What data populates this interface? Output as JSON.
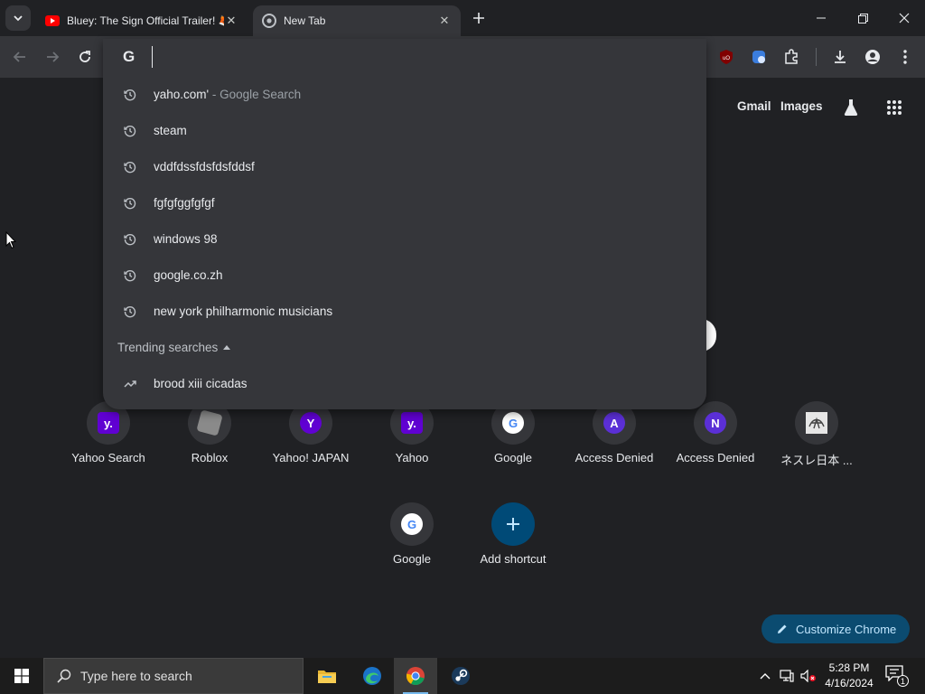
{
  "tabs": [
    {
      "title": "Bluey: The Sign Official Trailer! 🦊",
      "favicon": "youtube-icon",
      "active": false
    },
    {
      "title": "New Tab",
      "favicon": "chrome-icon",
      "active": true
    }
  ],
  "omnibox": {
    "input_value": "",
    "provider_icon": "G",
    "suggestions": [
      {
        "text": "yaho.com'",
        "suffix": " - Google Search",
        "icon": "history-icon"
      },
      {
        "text": "steam",
        "suffix": "",
        "icon": "history-icon"
      },
      {
        "text": "vddfdssfdsfdsfddsf",
        "suffix": "",
        "icon": "history-icon"
      },
      {
        "text": "fgfgfggfgfgf",
        "suffix": "",
        "icon": "history-icon"
      },
      {
        "text": "windows 98",
        "suffix": "",
        "icon": "history-icon"
      },
      {
        "text": "google.co.zh",
        "suffix": "",
        "icon": "history-icon"
      },
      {
        "text": "new york philharmonic musicians",
        "suffix": "",
        "icon": "history-icon"
      }
    ],
    "trending_heading": "Trending searches",
    "trending": [
      {
        "text": "brood xiii cicadas",
        "icon": "trending-icon"
      }
    ]
  },
  "extensions": [
    {
      "name": "ublock-origin-icon",
      "badge": "uO"
    },
    {
      "name": "extension-blue-icon"
    },
    {
      "name": "extensions-puzzle-icon"
    }
  ],
  "ntp": {
    "links": {
      "gmail": "Gmail",
      "images": "Images"
    },
    "shortcuts": [
      {
        "label": "Yahoo Search",
        "icon_text": "y.",
        "color": "#6001d2"
      },
      {
        "label": "Roblox",
        "icon_text": "",
        "color": "#8a8a8a"
      },
      {
        "label": "Yahoo! JAPAN",
        "icon_text": "Y",
        "color": "#6001d2"
      },
      {
        "label": "Yahoo",
        "icon_text": "y.",
        "color": "#6001d2"
      },
      {
        "label": "Google",
        "icon_text": "G",
        "color": "#4285f4"
      },
      {
        "label": "Access Denied",
        "icon_text": "A",
        "color": "#5b2fd6"
      },
      {
        "label": "Access Denied",
        "icon_text": "N",
        "color": "#5b2fd6"
      },
      {
        "label": "ネスレ日本 ...",
        "icon_text": "",
        "color": "#c0c0c0"
      }
    ],
    "shortcuts_row2": [
      {
        "label": "Google",
        "icon_text": "G"
      },
      {
        "label": "Add shortcut",
        "icon_text": "+"
      }
    ],
    "customize_label": "Customize Chrome"
  },
  "taskbar": {
    "search_placeholder": "Type here to search",
    "apps": [
      "file-explorer-icon",
      "edge-icon",
      "chrome-icon",
      "steam-icon"
    ],
    "time": "5:28 PM",
    "date": "4/16/2024",
    "notification_count": "1"
  },
  "colors": {
    "frame": "#202124",
    "toolbar": "#35363a",
    "text": "#e8eaed",
    "accent": "#0b4b70"
  }
}
